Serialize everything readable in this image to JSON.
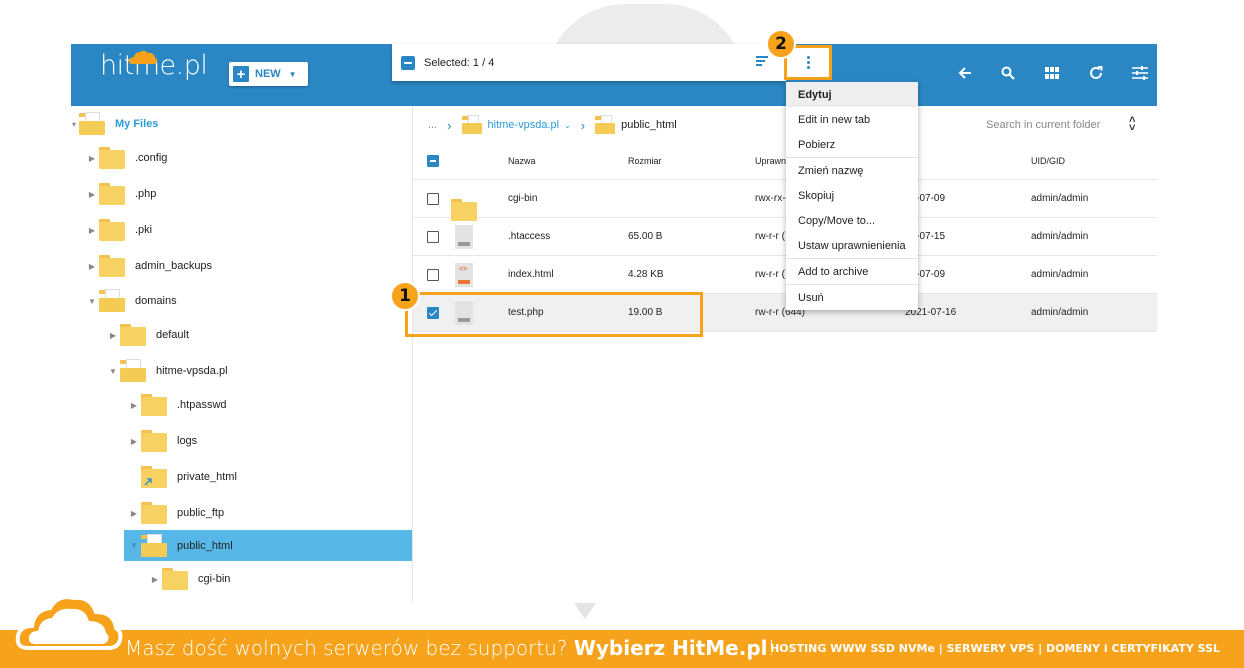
{
  "header": {
    "logo_text_a": "hitme",
    "logo_text_b": ".pl",
    "new_label": "NEW",
    "selected_label": "Selected: 1 / 4"
  },
  "badges": {
    "one": "1",
    "two": "2"
  },
  "header_icons": [
    "arrow-left-icon",
    "search-icon",
    "grid-view-icon",
    "refresh-icon",
    "settings-sliders-icon"
  ],
  "sidebar": {
    "root": "My Files",
    "items": [
      {
        "label": ".config"
      },
      {
        "label": ".php"
      },
      {
        "label": ".pki"
      },
      {
        "label": "admin_backups"
      },
      {
        "label": "domains"
      },
      {
        "label": "default"
      },
      {
        "label": "hitme-vpsda.pl"
      },
      {
        "label": ".htpasswd"
      },
      {
        "label": "logs"
      },
      {
        "label": "private_html"
      },
      {
        "label": "public_ftp"
      },
      {
        "label": "public_html"
      },
      {
        "label": "cgi-bin"
      }
    ]
  },
  "breadcrumb": {
    "ellipsis": "...",
    "domain": "hitme-vpsda.pl",
    "current": "public_html"
  },
  "search": {
    "placeholder": "Search in current folder"
  },
  "table": {
    "headers": {
      "name": "Nazwa",
      "size": "Rozmiar",
      "perm": "Uprawn",
      "date": "ta",
      "uid": "UID/GID"
    },
    "rows": [
      {
        "name": "cgi-bin",
        "size": "",
        "perm": "rwx-rx-",
        "date": "21-07-09",
        "uid": "admin/admin"
      },
      {
        "name": ".htaccess",
        "size": "65.00 B",
        "perm": "rw-r-r (",
        "date": "21-07-15",
        "uid": "admin/admin"
      },
      {
        "name": "index.html",
        "size": "4.28 KB",
        "perm": "rw-r-r (",
        "date": "21-07-09",
        "uid": "admin/admin"
      },
      {
        "name": "test.php",
        "size": "19.00 B",
        "perm": "rw-r-r (644)",
        "date": "2021-07-16",
        "uid": "admin/admin"
      }
    ]
  },
  "menu": {
    "items": [
      "Edytuj",
      "Edit in new tab",
      "Pobierz",
      "Zmień nazwę",
      "Skopiuj",
      "Copy/Move to...",
      "Ustaw uprawnienienia",
      "Add to archive",
      "Usuń"
    ]
  },
  "footer": {
    "promo_a": "Masz dość wolnych serwerów bez supportu? ",
    "promo_b": "Wybierz HitMe.pl",
    "promo_c": "!",
    "services": "HOSTING WWW SSD NVMe | SERWERY VPS | DOMENY i CERTYFIKATY SSL"
  },
  "colors": {
    "brand_blue": "#2b87c3",
    "accent_orange": "#f7a21b",
    "active_blue": "#57b8e8"
  }
}
